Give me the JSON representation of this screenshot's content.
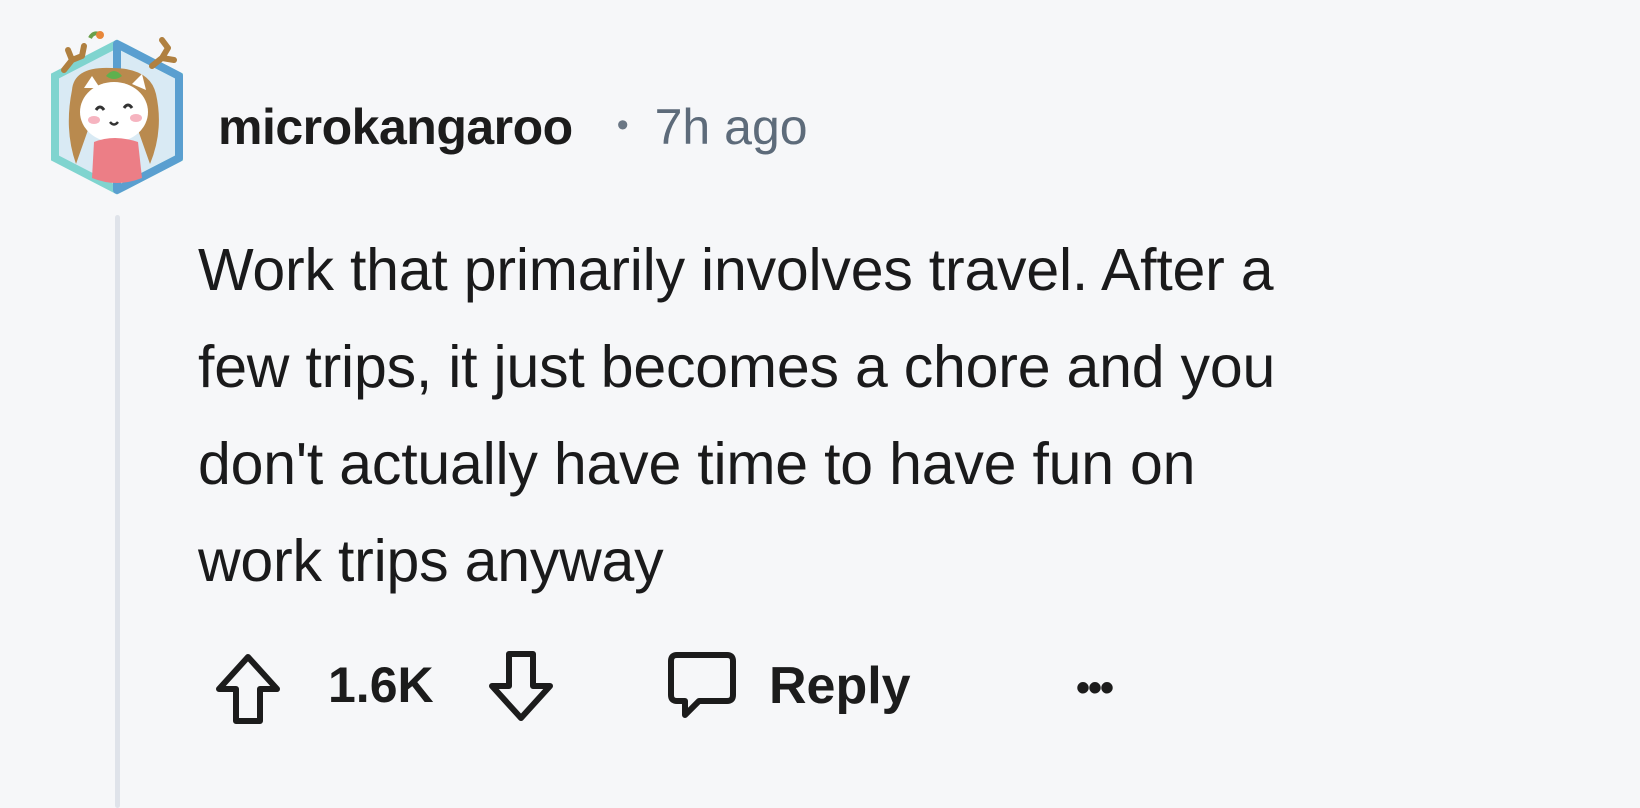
{
  "comment": {
    "author": "microkangaroo",
    "separator": "•",
    "time_ago": "7h ago",
    "body_lines": [
      "Work that primarily involves travel. After a",
      "few trips, it just becomes a chore and you",
      "don't actually have time to have fun on",
      "work trips anyway"
    ],
    "actions": {
      "score": "1.6K",
      "reply_label": "Reply",
      "more_label": "•••"
    }
  },
  "icons": {
    "avatar": "snoo-avatar-icon",
    "upvote": "upvote-arrow-icon",
    "downvote": "downvote-arrow-icon",
    "reply": "speech-bubble-icon",
    "more": "ellipsis-icon"
  }
}
